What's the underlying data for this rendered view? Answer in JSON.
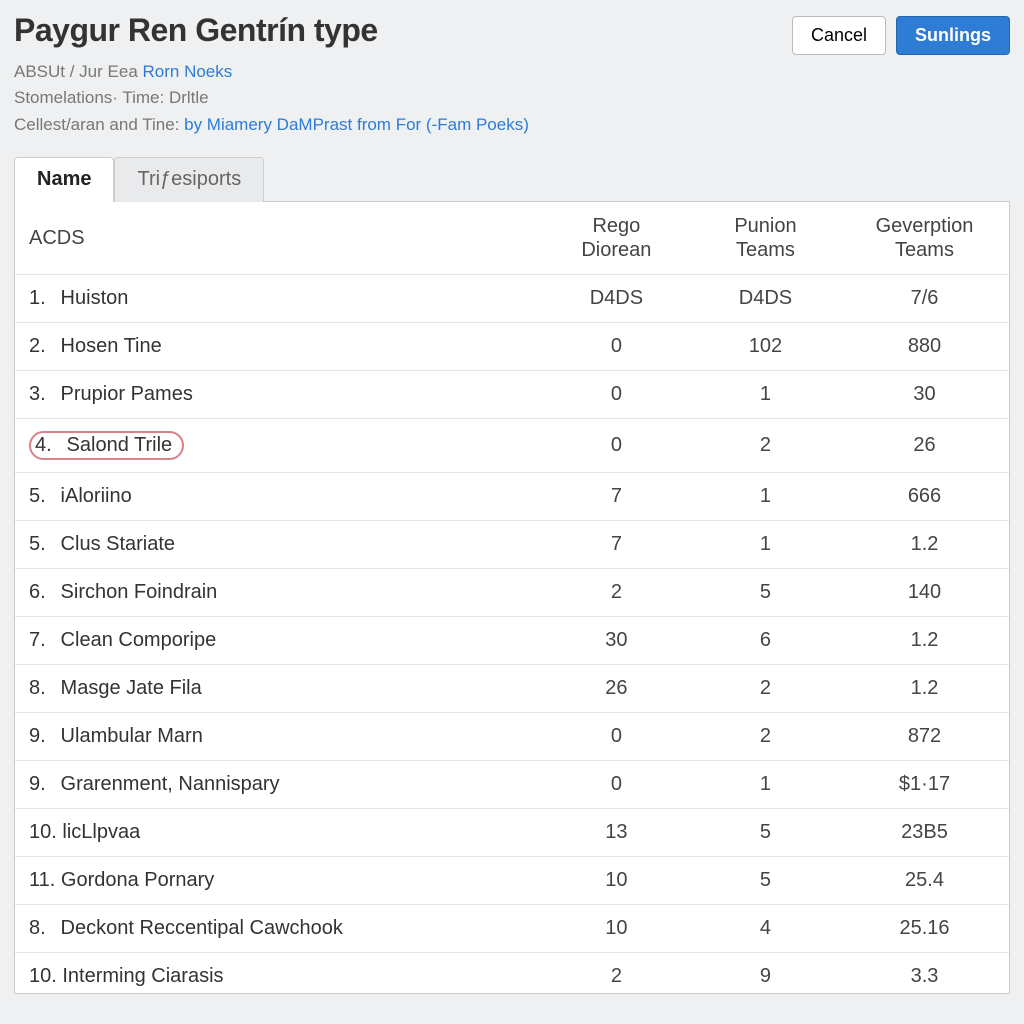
{
  "header": {
    "title": "Paygur Ren Gentrín type",
    "cancel_label": "Cancel",
    "submit_label": "Sunlings"
  },
  "meta": {
    "line1_prefix": "ABSUt / Jur Eea ",
    "line1_link": "Rorn Noeks",
    "line2": "Stomelations· Time: Drltle",
    "line3_prefix": "Cellest/aran and Tine: ",
    "line3_link": "by Miamery DaMPrast from For (-Fam Poeks)"
  },
  "tabs": [
    {
      "label": "Name",
      "active": true
    },
    {
      "label": "Triƒesiports",
      "active": false
    }
  ],
  "table": {
    "columns": {
      "name": "ACDS",
      "b": "Rego Diorean",
      "c": "Punion Teams",
      "d": "Geverption Teams"
    },
    "rows": [
      {
        "idx": "1.",
        "name": "Huiston",
        "b": "D4DS",
        "c": "D4DS",
        "d": "7/6",
        "circled": false
      },
      {
        "idx": "2.",
        "name": "Hosen Tine",
        "b": "0",
        "c": "102",
        "d": "880",
        "circled": false
      },
      {
        "idx": "3.",
        "name": "Prupior Pames",
        "b": "0",
        "c": "1",
        "d": "30",
        "circled": false
      },
      {
        "idx": "4.",
        "name": "Salond Trile",
        "b": "0",
        "c": "2",
        "d": "26",
        "circled": true
      },
      {
        "idx": "5.",
        "name": "iAloriino",
        "b": "7",
        "c": "1",
        "d": "666",
        "circled": false
      },
      {
        "idx": "5.",
        "name": "Clus Stariate",
        "b": "7",
        "c": "1",
        "d": "1.2",
        "circled": false
      },
      {
        "idx": "6.",
        "name": "Sirchon Foindrain",
        "b": "2",
        "c": "5",
        "d": "140",
        "circled": false
      },
      {
        "idx": "7.",
        "name": "Clean Comporipe",
        "b": "30",
        "c": "6",
        "d": "1.2",
        "circled": false
      },
      {
        "idx": "8.",
        "name": "Masge Jate Fila",
        "b": "26",
        "c": "2",
        "d": "1.2",
        "circled": false
      },
      {
        "idx": "9.",
        "name": "Ulambular Marn",
        "b": "0",
        "c": "2",
        "d": "872",
        "circled": false
      },
      {
        "idx": "9.",
        "name": "Grarenment, Nannispary",
        "b": "0",
        "c": "1",
        "d": "$1·17",
        "circled": false
      },
      {
        "idx": "10.",
        "name": "licLlpvaa",
        "b": "13",
        "c": "5",
        "d": "23B5",
        "circled": false
      },
      {
        "idx": "11.",
        "name": "Gordona Pornary",
        "b": "10",
        "c": "5",
        "d": "25.4",
        "circled": false
      },
      {
        "idx": "8.",
        "name": "Deckont Reccentipal Cawchook",
        "b": "10",
        "c": "4",
        "d": "25.16",
        "circled": false
      },
      {
        "idx": "10.",
        "name": "Interming Ciarasis",
        "b": "2",
        "c": "9",
        "d": "3.3",
        "circled": false
      }
    ]
  }
}
